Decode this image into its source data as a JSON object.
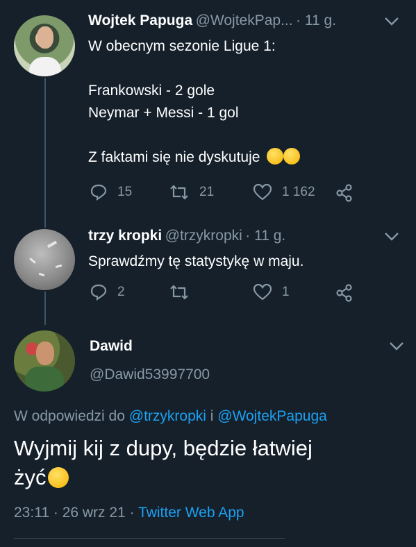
{
  "tweet1": {
    "name": "Wojtek Papuga",
    "handle": "@WojtekPap...",
    "time": "· 11 g.",
    "lines": [
      "W obecnym sezonie Ligue 1:",
      "",
      "Frankowski - 2 gole",
      "Neymar + Messi - 1 gol",
      "",
      "Z faktami się nie dyskutuje"
    ],
    "emoji1": "sweat-smile-emoji",
    "emoji2": "wink-emoji",
    "replies": "15",
    "retweets": "21",
    "likes": "1 162"
  },
  "tweet2": {
    "name": "trzy kropki",
    "handle": "@trzykropki",
    "time": "· 11 g.",
    "text": "Sprawdźmy tę statystykę w maju.",
    "replies": "2",
    "retweets": "",
    "likes": "1"
  },
  "tweet3": {
    "name": "Dawid",
    "handle": "@Dawid53997700",
    "reply_prefix": "W odpowiedzi do",
    "reply_user1": "@trzykropki",
    "reply_and": "i",
    "reply_user2": "@WojtekPapuga",
    "text_line1": "Wyjmij kij z dupy, będzie łatwiej",
    "text_line2": "żyć",
    "emoji": "wink-emoji",
    "time": "23:11",
    "sep1": "·",
    "date": "26 wrz 21",
    "sep2": "·",
    "source": "Twitter Web App"
  },
  "icons": {
    "reply": "reply-icon",
    "retweet": "retweet-icon",
    "like": "heart-icon",
    "share": "share-icon",
    "more": "chevron-down-icon"
  },
  "colors": {
    "background": "#15202b",
    "secondary_text": "#8899a6",
    "link": "#1da1f2",
    "thread_line": "#3d5466"
  }
}
